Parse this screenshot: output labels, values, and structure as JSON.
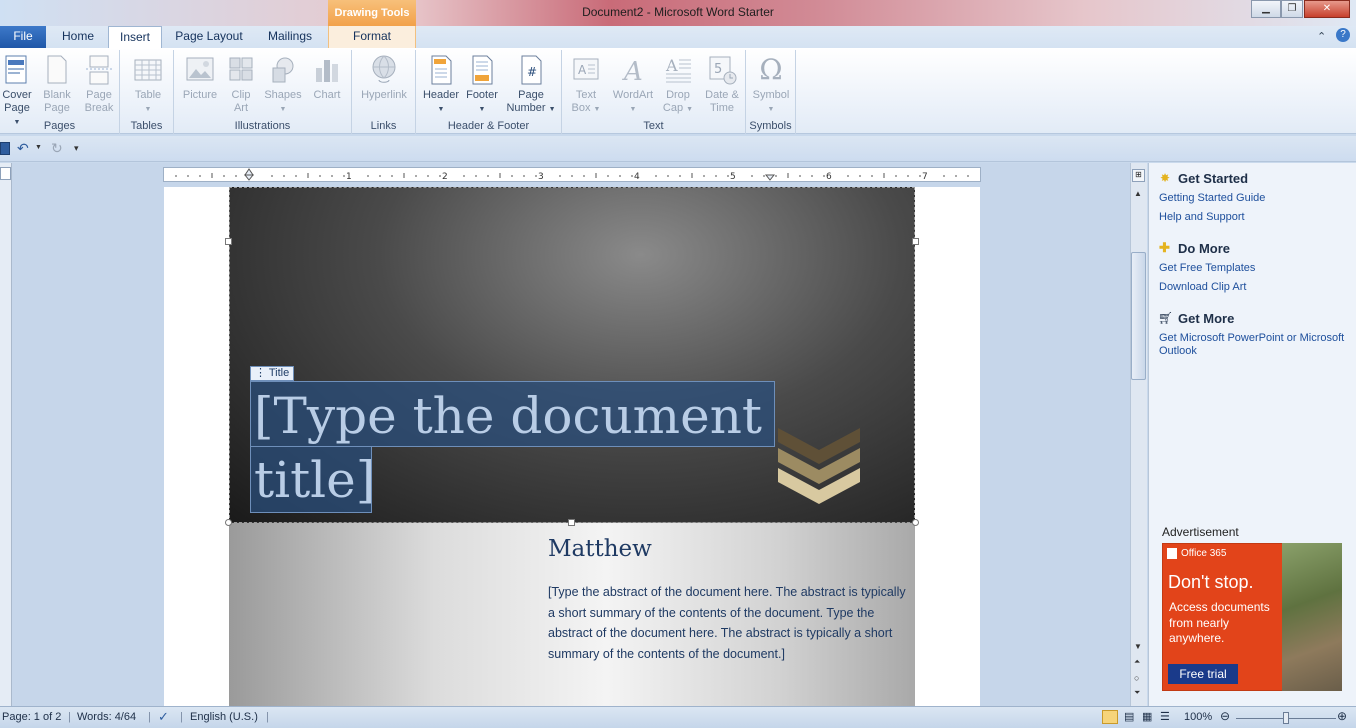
{
  "window": {
    "title": "Document2 - Microsoft Word Starter",
    "contextual_tab": "Drawing Tools"
  },
  "tabs": [
    {
      "label": "File"
    },
    {
      "label": "Home"
    },
    {
      "label": "Insert",
      "active": true
    },
    {
      "label": "Page Layout"
    },
    {
      "label": "Mailings"
    },
    {
      "label": "Format"
    }
  ],
  "ribbon": {
    "groups": [
      {
        "label": "Pages",
        "buttons": [
          {
            "label": "Cover Page",
            "icon": "cover-page-icon"
          },
          {
            "label": "Blank Page",
            "icon": "blank-page-icon",
            "disabled": true
          },
          {
            "label": "Page Break",
            "icon": "page-break-icon",
            "disabled": true
          }
        ]
      },
      {
        "label": "Tables",
        "buttons": [
          {
            "label": "Table",
            "icon": "table-icon",
            "disabled": true
          }
        ]
      },
      {
        "label": "Illustrations",
        "buttons": [
          {
            "label": "Picture",
            "icon": "picture-icon",
            "disabled": true
          },
          {
            "label": "Clip Art",
            "icon": "clip-art-icon",
            "disabled": true
          },
          {
            "label": "Shapes",
            "icon": "shapes-icon",
            "disabled": true
          },
          {
            "label": "Chart",
            "icon": "chart-icon",
            "disabled": true
          }
        ]
      },
      {
        "label": "Links",
        "buttons": [
          {
            "label": "Hyperlink",
            "icon": "hyperlink-icon",
            "disabled": true
          }
        ]
      },
      {
        "label": "Header & Footer",
        "buttons": [
          {
            "label": "Header",
            "icon": "header-icon"
          },
          {
            "label": "Footer",
            "icon": "footer-icon"
          },
          {
            "label": "Page Number",
            "icon": "page-number-icon"
          }
        ]
      },
      {
        "label": "Text",
        "buttons": [
          {
            "label": "Text Box",
            "icon": "text-box-icon",
            "disabled": true
          },
          {
            "label": "WordArt",
            "icon": "wordart-icon",
            "disabled": true
          },
          {
            "label": "Drop Cap",
            "icon": "drop-cap-icon",
            "disabled": true
          },
          {
            "label": "Date & Time",
            "icon": "date-time-icon",
            "disabled": true
          }
        ]
      },
      {
        "label": "Symbols",
        "buttons": [
          {
            "label": "Symbol",
            "icon": "omega-icon",
            "disabled": true
          }
        ]
      }
    ]
  },
  "document": {
    "title_tag": "Title",
    "title_placeholder": "[Type the document title]",
    "author": "Matthew",
    "abstract": "[Type the abstract of the document here. The abstract is typically a short summary of the contents of the document. Type the abstract of the document here. The abstract is typically a short summary of the contents of the document.]"
  },
  "task_pane": {
    "sections": [
      {
        "heading": "Get Started",
        "icon": "star-icon",
        "links": [
          "Getting Started Guide",
          "Help and Support"
        ]
      },
      {
        "heading": "Do More",
        "icon": "plus-icon",
        "links": [
          "Get Free Templates",
          "Download Clip Art"
        ]
      },
      {
        "heading": "Get More",
        "icon": "cart-icon",
        "links": [
          "Get Microsoft PowerPoint or Microsoft Outlook"
        ]
      }
    ],
    "advertisement": {
      "label": "Advertisement",
      "brand": "Office 365",
      "headline": "Don't stop.",
      "body": "Access documents from nearly anywhere.",
      "cta": "Free trial"
    }
  },
  "status_bar": {
    "page": "Page: 1 of 2",
    "words": "Words: 4/64",
    "language": "English (U.S.)",
    "zoom": "100%"
  },
  "colors": {
    "accent": "#2b579a",
    "ad_background": "#e2441a",
    "title_selection": "#2a4d7b"
  }
}
